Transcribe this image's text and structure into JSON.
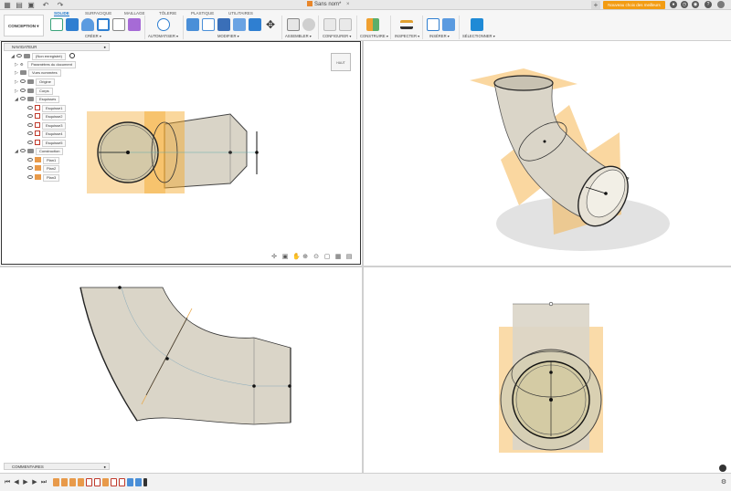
{
  "titlebar": {
    "document_title": "Sans nom*",
    "new_button": "Nouveau choix des meilleurs"
  },
  "ribbon": {
    "workspace": "CONCEPTION ▾",
    "tabs": [
      "SOLIDE",
      "SURFACIQUE",
      "MAILLAGE",
      "TÔLERIE",
      "PLASTIQUE",
      "UTILITAIRES"
    ],
    "groups": [
      "CRÉER ▾",
      "AUTOMATISER ▾",
      "MODIFIER ▾",
      "ASSEMBLER ▾",
      "CONFIGURER ▾",
      "CONSTRUIRE ▾",
      "INSPECTER ▾",
      "INSÉRER ▾",
      "SÉLECTIONNER ▾"
    ]
  },
  "navigator": {
    "title": "NAVIGATEUR",
    "root": "(Non enregistré)",
    "items": [
      {
        "label": "Paramètres du document"
      },
      {
        "label": "Vues nommées"
      },
      {
        "label": "Origine"
      },
      {
        "label": "Corps"
      },
      {
        "label": "Esquisses"
      },
      {
        "label": "Esquisse1"
      },
      {
        "label": "Esquisse2"
      },
      {
        "label": "Esquisse3"
      },
      {
        "label": "Esquisse4"
      },
      {
        "label": "Esquisse5"
      },
      {
        "label": "Construction"
      },
      {
        "label": "Plan1"
      },
      {
        "label": "Plan2"
      },
      {
        "label": "Plan3"
      }
    ]
  },
  "viewcube": {
    "label": "HAUT"
  },
  "comments": {
    "title": "COMMENTAIRES"
  },
  "colors": {
    "accent": "#1f77c9",
    "plane": "#f5b041",
    "body": "#d9d4c7",
    "orange_button": "#f39c12"
  }
}
